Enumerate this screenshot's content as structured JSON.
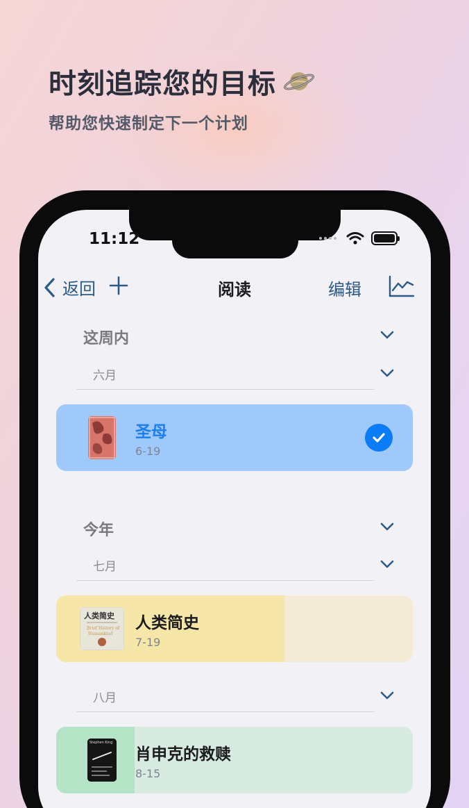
{
  "promo": {
    "headline": "时刻追踪您的目标",
    "subline": "帮助您快速制定下一个计划"
  },
  "status_bar": {
    "time": "11:12"
  },
  "nav": {
    "back_label": "返回",
    "title": "阅读",
    "edit_label": "编辑"
  },
  "sections": [
    {
      "title": "这周内",
      "months": [
        {
          "title": "六月",
          "books": [
            {
              "title": "圣母",
              "date": "6-19",
              "completed": true,
              "progress": 1.0,
              "color": "#9fc8fb",
              "title_color": "#1a7ff0"
            }
          ]
        }
      ]
    },
    {
      "title": "今年",
      "months": [
        {
          "title": "七月",
          "books": [
            {
              "title": "人类简史",
              "date": "7-19",
              "completed": false,
              "progress": 0.64,
              "color": "#f6e6a8",
              "track_color": "#f3ebd6"
            }
          ]
        },
        {
          "title": "八月",
          "books": [
            {
              "title": "肖申克的救赎",
              "date": "8-15",
              "completed": false,
              "progress": 0.22,
              "color": "#b4e3c5",
              "track_color": "#d7ebe0"
            }
          ]
        }
      ]
    }
  ],
  "covers": {
    "sapiens": {
      "title": "人类简史"
    },
    "shawshank": {
      "author": "Stephen King"
    }
  },
  "colors": {
    "accent": "#2a5a87",
    "check": "#0a7cf7"
  }
}
